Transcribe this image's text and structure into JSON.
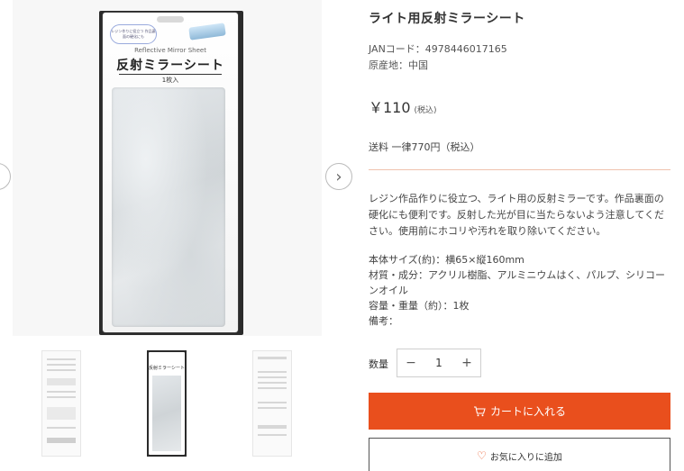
{
  "gallery": {
    "prev_arrow": "‹",
    "next_arrow": "›",
    "package": {
      "note": "レジン作りに役立つ 作品裏面の硬化にも",
      "subtitle": "Reflective Mirror Sheet",
      "title": "反射ミラーシート",
      "count": "1枚入"
    },
    "thumbnails": [
      {
        "name": "back-of-package"
      },
      {
        "name": "front-of-package",
        "title": "反射ミラーシート"
      },
      {
        "name": "instructions-sheet"
      }
    ]
  },
  "product": {
    "title": "ライト用反射ミラーシート",
    "jan": "JANコード：4978446017165",
    "origin": "原産地：中国",
    "price": "￥110",
    "price_tax": "(税込)",
    "shipping": "送料 一律770円（税込）",
    "description": "レジン作品作りに役立つ、ライト用の反射ミラーです。作品裏面の硬化にも便利です。反射した光が目に当たらないよう注意してください。使用前にホコリや汚れを取り除いてください。",
    "specs": {
      "size": "本体サイズ(約)：横65×縦160mm",
      "material": "材質・成分：アクリル樹脂、アルミニウムはく、パルプ、シリコーンオイル",
      "capacity": "容量・重量（約）：1枚",
      "remarks": "備考："
    },
    "quantity": {
      "label": "数量",
      "minus": "−",
      "value": "1",
      "plus": "+"
    },
    "cart_button": "カートに入れる",
    "favorite_button": "お気に入りに追加"
  },
  "colors": {
    "accent": "#e94f1d",
    "divider": "#f0c2ad"
  }
}
